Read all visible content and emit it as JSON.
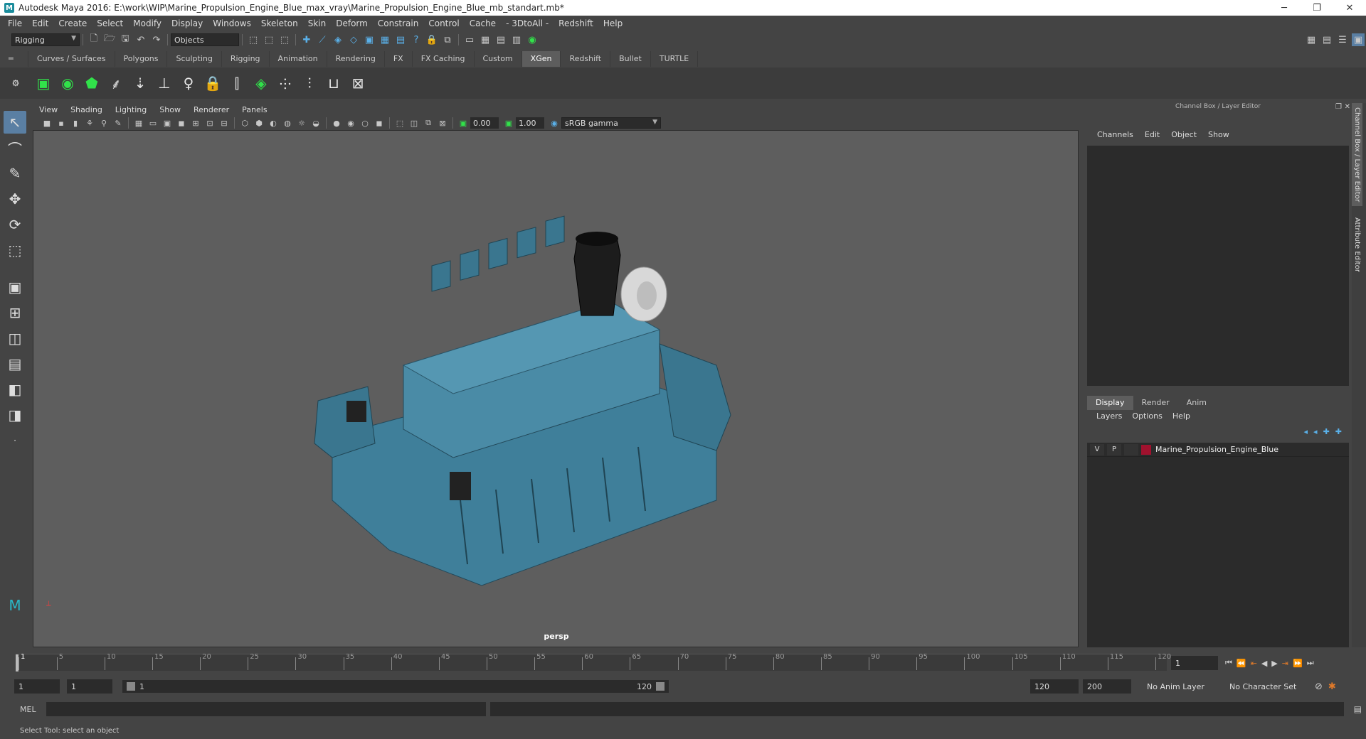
{
  "titlebar": {
    "title": "Autodesk Maya 2016: E:\\work\\WIP\\Marine_Propulsion_Engine_Blue_max_vray\\Marine_Propulsion_Engine_Blue_mb_standart.mb*",
    "min": "─",
    "restore": "❐",
    "close": "✕"
  },
  "menubar": [
    "File",
    "Edit",
    "Create",
    "Select",
    "Modify",
    "Display",
    "Windows",
    "Skeleton",
    "Skin",
    "Deform",
    "Constrain",
    "Control",
    "Cache",
    "- 3DtoAll -",
    "Redshift",
    "Help"
  ],
  "toolbar": {
    "mode": "Rigging",
    "selection_mode": "Objects"
  },
  "shelf_tabs": [
    "Curves / Surfaces",
    "Polygons",
    "Sculpting",
    "Rigging",
    "Animation",
    "Rendering",
    "FX",
    "FX Caching",
    "Custom",
    "XGen",
    "Redshift",
    "Bullet",
    "TURTLE"
  ],
  "shelf_active": "XGen",
  "viewport": {
    "menu": [
      "View",
      "Shading",
      "Lighting",
      "Show",
      "Renderer",
      "Panels"
    ],
    "exposure": "0.00",
    "gamma": "1.00",
    "color_space": "sRGB gamma",
    "camera": "persp"
  },
  "channel_box": {
    "title": "Channel Box / Layer Editor",
    "menu": [
      "Channels",
      "Edit",
      "Object",
      "Show"
    ]
  },
  "layer_editor": {
    "tabs": [
      "Display",
      "Render",
      "Anim"
    ],
    "active_tab": "Display",
    "menu": [
      "Layers",
      "Options",
      "Help"
    ],
    "layers": [
      {
        "v": "V",
        "p": "P",
        "name": "Marine_Propulsion_Engine_Blue",
        "color": "#a0122e"
      }
    ]
  },
  "side_tabs": [
    "Channel Box / Layer Editor",
    "Attribute Editor"
  ],
  "timeline": {
    "ticks": [
      "1",
      "5",
      "10",
      "15",
      "20",
      "25",
      "30",
      "35",
      "40",
      "45",
      "50",
      "55",
      "60",
      "65",
      "70",
      "75",
      "80",
      "85",
      "90",
      "95",
      "100",
      "105",
      "110",
      "115",
      "120"
    ],
    "current_frame": "1"
  },
  "range": {
    "start": "1",
    "anim_start": "1",
    "range_start": "1",
    "range_end": "120",
    "anim_end": "120",
    "end": "200",
    "anim_layer": "No Anim Layer",
    "char_set": "No Character Set"
  },
  "mel": {
    "label": "MEL"
  },
  "status": {
    "text": "Select Tool: select an object"
  },
  "colors": {
    "engine": "#3f7f9a",
    "viewport_bg": "#5e5e5e",
    "layer_color": "#a0122e"
  }
}
